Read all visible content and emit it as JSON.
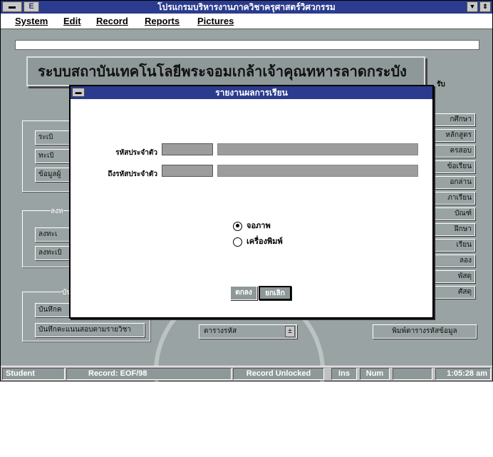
{
  "window": {
    "title": "โปรแกรมบริหารงานภาควิชาครุศาสตร์วิศวกรรม",
    "app_icon_label": "E",
    "sys_menu_glyph": "▬",
    "minimize_glyph": "▼",
    "restore_glyph": "⇕"
  },
  "menubar": {
    "items": [
      "System",
      "Edit",
      "Record",
      "Reports",
      "Pictures"
    ]
  },
  "banner": {
    "text": "ระบบสถาบันเทคโนโลยีพระจอมเกล้าเจ้าคุณทหารลาดกระบัง"
  },
  "background": {
    "right_label": "รับ",
    "left_group1_buttons": [
      "ระเบิ",
      "ทะเบิ",
      "ข้อมูลผู้"
    ],
    "left_group2_title": "ลงท",
    "left_group2_buttons": [
      "ลงทะเ",
      "ลงทะเบิ"
    ],
    "left_group3_title": "บัน",
    "left_group3_buttons": [
      "บันทึกค",
      "บันทึกคะแนนสอบตามรายวิชา"
    ],
    "right_buttons": [
      "กศึกษา",
      "หลักสูตร",
      "ครสอบ",
      "ข้อเรียน",
      "อกล่าน",
      "ภาเรียน",
      "บัณฑ์",
      "ฝึกษา",
      "เรียน",
      "ลอง",
      "พัสดุ",
      "ศัสดุ"
    ],
    "print_button": "พิมพ์ตารางรหัสข้อมูล",
    "combo_value": "ตารางรหัส",
    "combo_arrow": "±"
  },
  "dialog": {
    "title": "รายงานผลการเรียน",
    "sys_glyph": "▬",
    "from_label": "รหัสประจำตัว",
    "to_label": "ถึงรหัสประจำตัว",
    "from_code": "",
    "from_name": "",
    "to_code": "",
    "to_name": "",
    "radio_screen": "จอภาพ",
    "radio_printer": "เครื่องพิมพ์",
    "selected_output": "screen",
    "ok_label": "ตกลง",
    "cancel_label": "ยกเลิก"
  },
  "statusbar": {
    "form": "Student",
    "record": "Record: EOF/98",
    "lock": "Record Unlocked",
    "ins": "Ins",
    "num": "Num",
    "empty": "",
    "time": "1:05:28 am"
  },
  "colors": {
    "titlebar": "#2b3b8e",
    "desktop": "#9aa3a3",
    "dialog_bg": "#ffffff",
    "field": "#9c9c9c"
  }
}
